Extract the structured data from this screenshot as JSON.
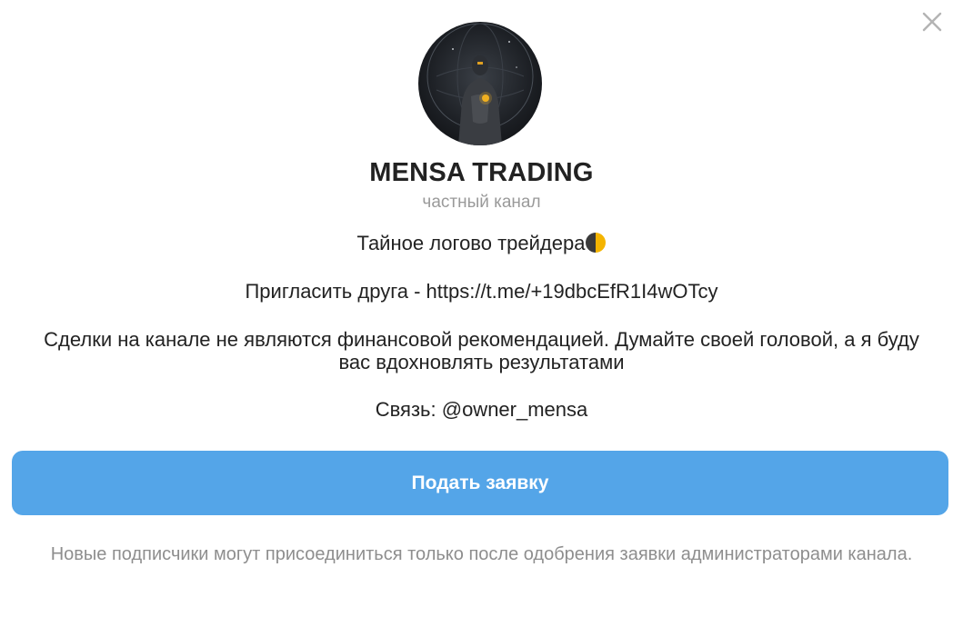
{
  "channel": {
    "title": "MENSA TRADING",
    "subtitle": "частный канал"
  },
  "description": {
    "line1": "Тайное логово трейдера",
    "line1_emoji": "new-moon-half-icon",
    "line2": "Пригласить друга - https://t.me/+19dbcEfR1I4wOTcy",
    "line3": "Сделки на канале не являются финансовой рекомендацией. Думайте своей головой, а я буду вас вдохновлять результатами",
    "line4": "Связь: @owner_mensa"
  },
  "actions": {
    "join_label": "Подать заявку",
    "join_color": "#54a5e8",
    "close_icon": "close-icon"
  },
  "footer": {
    "note": "Новые подписчики могут присоединиться только после одобрения заявки администраторами канала."
  }
}
